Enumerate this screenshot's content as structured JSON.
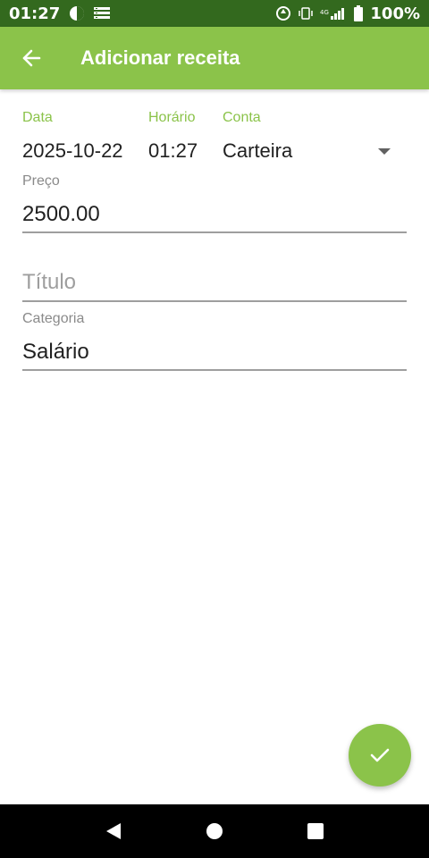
{
  "status_bar": {
    "time": "01:27",
    "battery": "100%",
    "network_label": "4G"
  },
  "app_bar": {
    "title": "Adicionar receita"
  },
  "form": {
    "date": {
      "label": "Data",
      "value": "2025-10-22"
    },
    "time": {
      "label": "Horário",
      "value": "01:27"
    },
    "account": {
      "label": "Conta",
      "value": "Carteira"
    },
    "price": {
      "label": "Preço",
      "value": "2500.00"
    },
    "title": {
      "placeholder": "Título",
      "value": ""
    },
    "category": {
      "label": "Categoria",
      "value": "Salário"
    }
  },
  "colors": {
    "status_bar": "#33691e",
    "app_bar": "#8bc34a",
    "accent": "#8bc34a",
    "nav_bar": "#000000"
  },
  "icons": {
    "back": "arrow-left-icon",
    "confirm": "check-icon",
    "dropdown": "triangle-down-icon",
    "nav_back": "triangle-back-icon",
    "nav_home": "circle-home-icon",
    "nav_recents": "square-recents-icon"
  }
}
